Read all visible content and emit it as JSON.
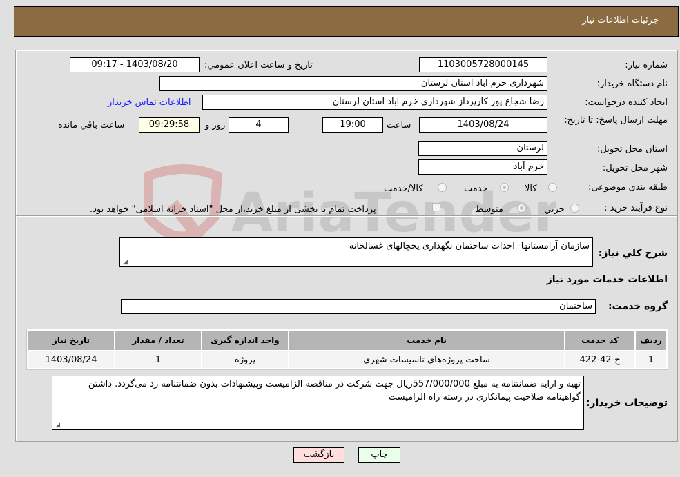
{
  "header": {
    "title": "جزئیات اطلاعات نیاز"
  },
  "form": {
    "need_number": {
      "label": "شماره نیاز:",
      "value": "1103005728000145"
    },
    "announce_datetime": {
      "label": "تاریخ و ساعت اعلان عمومي:",
      "value": "1403/08/20 - 09:17"
    },
    "buyer_org": {
      "label": "نام دستگاه خریدار:",
      "value": "شهرداری خرم اباد استان لرستان"
    },
    "requester": {
      "label": "ایجاد کننده درخواست:",
      "value": "رضا شجاع پور کارپرداز شهرداری خرم اباد استان لرستان",
      "contact_link": "اطلاعات تماس خریدار"
    },
    "deadline": {
      "label": "مهلت ارسال پاسخ: تا تاریخ:",
      "date": "1403/08/24",
      "time_label": "ساعت",
      "time": "19:00",
      "days": "4",
      "days_label": "روز و",
      "remaining": "09:29:58",
      "remaining_label": "ساعت باقي مانده"
    },
    "delivery_province": {
      "label": "استان محل تحویل:",
      "value": "لرستان"
    },
    "delivery_city": {
      "label": "شهر محل تحویل:",
      "value": "خرم آباد"
    },
    "category": {
      "label": "طبقه بندی موضوعی:",
      "options": [
        "کالا",
        "خدمت",
        "کالا/خدمت"
      ],
      "selected": "خدمت"
    },
    "purchase_type": {
      "label": "نوع فرآیند خرید :",
      "options": [
        "جزیي",
        "متوسط"
      ],
      "selected": "متوسط",
      "treasury_note": "پرداخت تمام یا بخشی از مبلغ خرید،از محل \"اسناد خزانه اسلامی\" خواهد بود."
    }
  },
  "details": {
    "summary_label": "شرح کلي نیاز:",
    "summary": "سازمان آرامستانها- احداث ساختمان نگهداری یخچالهای غسالخانه",
    "services_heading": "اطلاعات خدمات مورد نیاز",
    "service_group_label": "گروه خدمت:",
    "service_group": "ساختمان",
    "table": {
      "headers": [
        "ردیف",
        "کد خدمت",
        "نام خدمت",
        "واحد اندازه گیری",
        "تعداد / مقدار",
        "تاریخ نیاز"
      ],
      "rows": [
        [
          "1",
          "ج-42-422",
          "ساخت پروژه‌های تاسیسات شهری",
          "پروژه",
          "1",
          "1403/08/24"
        ]
      ]
    },
    "buyer_notes_label": "توضیحات خریدار:",
    "buyer_notes": "تهیه و ارایه ضمانتنامه به مبلغ 557/000/000ریال جهت شرکت در مناقصه الزامیست وپیشنهادات بدون ضمانتنامه رد می‌گردد. داشتن گواهینامه صلاحیت پیمانکاری در رسته راه الزامیست"
  },
  "buttons": {
    "print": "چاپ",
    "back": "بازگشت"
  },
  "watermark": {
    "text": "AriaTender.neT"
  },
  "colors": {
    "header_bg": "#8b6c42",
    "print_bg": "#eaffea",
    "back_bg": "#ffdede",
    "link": "#1a1aff"
  }
}
